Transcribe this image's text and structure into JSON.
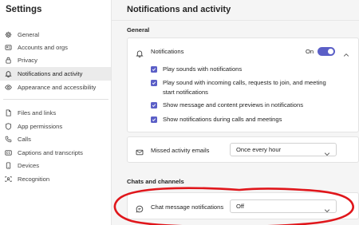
{
  "sidebar": {
    "title": "Settings",
    "items": [
      {
        "label": "General",
        "icon": "gear-icon"
      },
      {
        "label": "Accounts and orgs",
        "icon": "accounts-icon"
      },
      {
        "label": "Privacy",
        "icon": "lock-icon"
      },
      {
        "label": "Notifications and activity",
        "icon": "bell-icon",
        "active": true
      },
      {
        "label": "Appearance and accessibility",
        "icon": "eye-icon"
      },
      {
        "label": "Files and links",
        "icon": "file-icon"
      },
      {
        "label": "App permissions",
        "icon": "shield-icon"
      },
      {
        "label": "Calls",
        "icon": "phone-icon"
      },
      {
        "label": "Captions and transcripts",
        "icon": "captions-icon"
      },
      {
        "label": "Devices",
        "icon": "device-icon"
      },
      {
        "label": "Recognition",
        "icon": "recognition-icon"
      }
    ]
  },
  "main": {
    "title": "Notifications and activity",
    "general": {
      "section_title": "General",
      "notifications": {
        "label": "Notifications",
        "icon": "bell-icon",
        "toggle_text": "On",
        "toggle_on": true,
        "options": [
          {
            "label": "Play sounds with notifications",
            "checked": true
          },
          {
            "label": "Play sound with incoming calls, requests to join, and meeting start notifications",
            "checked": true
          },
          {
            "label": "Show message and content previews in notifications",
            "checked": true
          },
          {
            "label": "Show notifications during calls and meetings",
            "checked": true
          }
        ]
      },
      "missed_activity": {
        "label": "Missed activity emails",
        "icon": "mail-icon",
        "value": "Once every hour"
      }
    },
    "chats": {
      "section_title": "Chats and channels",
      "chat_message": {
        "label": "Chat message notifications",
        "icon": "chat-icon",
        "value": "Off"
      }
    }
  },
  "colors": {
    "accent": "#5b5fc7",
    "annotation": "#e0161b",
    "main_bg": "#f5f5f5",
    "active_nav_bg": "#ebebeb"
  }
}
